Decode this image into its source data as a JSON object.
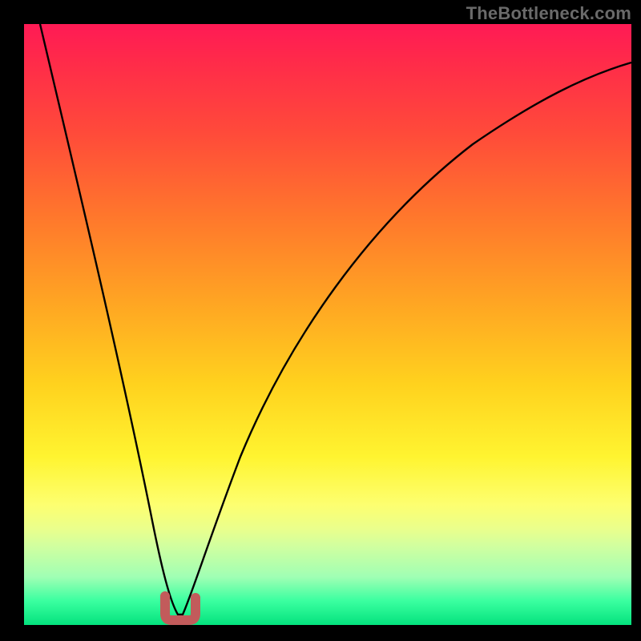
{
  "watermark": "TheBottleneck.com",
  "chart_data": {
    "type": "line",
    "title": "",
    "xlabel": "",
    "ylabel": "",
    "xlim": [
      0,
      100
    ],
    "ylim": [
      0,
      100
    ],
    "background_gradient": {
      "top": "#ff1a55",
      "mid": "#fff430",
      "bottom": "#04e27d"
    },
    "series": [
      {
        "name": "bottleneck-curve",
        "color": "#000000",
        "x": [
          3,
          5,
          8,
          12,
          16,
          20,
          22,
          24,
          26,
          28,
          30,
          35,
          40,
          45,
          50,
          55,
          60,
          65,
          70,
          75,
          80,
          85,
          90,
          95,
          100
        ],
        "y": [
          100,
          90,
          78,
          62,
          44,
          22,
          10,
          3,
          1,
          3,
          12,
          30,
          44,
          55,
          63,
          70,
          75,
          80,
          83,
          86,
          88,
          90,
          91,
          92,
          93
        ]
      }
    ],
    "marker": {
      "name": "minimum-segment",
      "color": "#c25b5b",
      "x_range": [
        23.5,
        27.5
      ],
      "y": 1
    }
  }
}
